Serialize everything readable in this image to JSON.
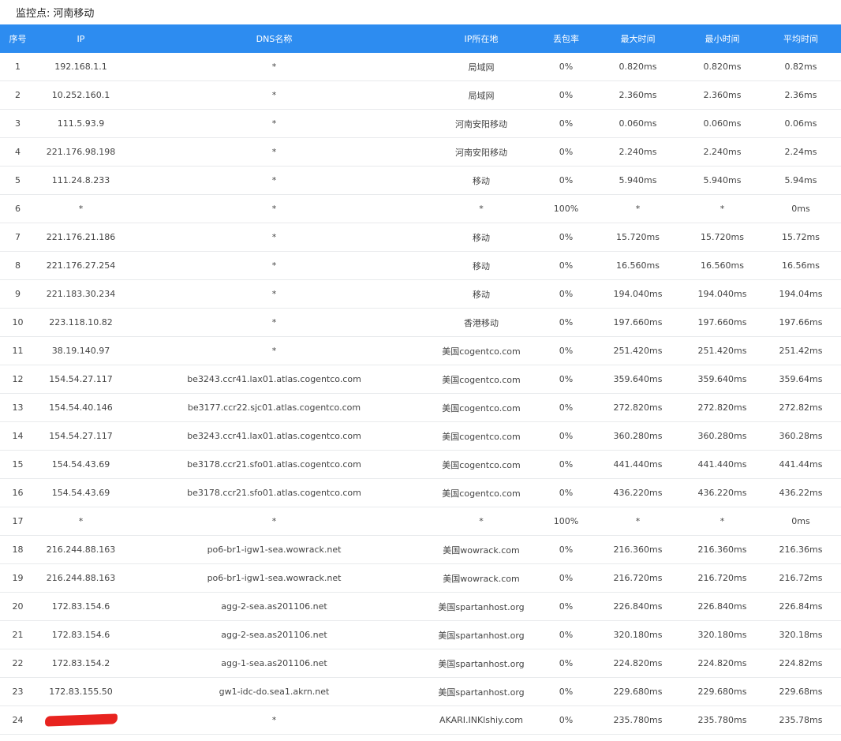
{
  "header": {
    "label": "监控点:",
    "value": "河南移动"
  },
  "table": {
    "columns": [
      "序号",
      "IP",
      "DNS名称",
      "IP所在地",
      "丢包率",
      "最大时间",
      "最小时间",
      "平均时间"
    ],
    "rows": [
      {
        "no": "1",
        "ip": "192.168.1.1",
        "dns": "*",
        "loc": "局域网",
        "loss": "0%",
        "max": "0.820ms",
        "min": "0.820ms",
        "avg": "0.82ms"
      },
      {
        "no": "2",
        "ip": "10.252.160.1",
        "dns": "*",
        "loc": "局域网",
        "loss": "0%",
        "max": "2.360ms",
        "min": "2.360ms",
        "avg": "2.36ms"
      },
      {
        "no": "3",
        "ip": "111.5.93.9",
        "dns": "*",
        "loc": "河南安阳移动",
        "loss": "0%",
        "max": "0.060ms",
        "min": "0.060ms",
        "avg": "0.06ms"
      },
      {
        "no": "4",
        "ip": "221.176.98.198",
        "dns": "*",
        "loc": "河南安阳移动",
        "loss": "0%",
        "max": "2.240ms",
        "min": "2.240ms",
        "avg": "2.24ms"
      },
      {
        "no": "5",
        "ip": "111.24.8.233",
        "dns": "*",
        "loc": "移动",
        "loss": "0%",
        "max": "5.940ms",
        "min": "5.940ms",
        "avg": "5.94ms"
      },
      {
        "no": "6",
        "ip": "*",
        "dns": "*",
        "loc": "*",
        "loss": "100%",
        "max": "*",
        "min": "*",
        "avg": "0ms"
      },
      {
        "no": "7",
        "ip": "221.176.21.186",
        "dns": "*",
        "loc": "移动",
        "loss": "0%",
        "max": "15.720ms",
        "min": "15.720ms",
        "avg": "15.72ms"
      },
      {
        "no": "8",
        "ip": "221.176.27.254",
        "dns": "*",
        "loc": "移动",
        "loss": "0%",
        "max": "16.560ms",
        "min": "16.560ms",
        "avg": "16.56ms"
      },
      {
        "no": "9",
        "ip": "221.183.30.234",
        "dns": "*",
        "loc": "移动",
        "loss": "0%",
        "max": "194.040ms",
        "min": "194.040ms",
        "avg": "194.04ms"
      },
      {
        "no": "10",
        "ip": "223.118.10.82",
        "dns": "*",
        "loc": "香港移动",
        "loss": "0%",
        "max": "197.660ms",
        "min": "197.660ms",
        "avg": "197.66ms"
      },
      {
        "no": "11",
        "ip": "38.19.140.97",
        "dns": "*",
        "loc": "美国cogentco.com",
        "loss": "0%",
        "max": "251.420ms",
        "min": "251.420ms",
        "avg": "251.42ms"
      },
      {
        "no": "12",
        "ip": "154.54.27.117",
        "dns": "be3243.ccr41.lax01.atlas.cogentco.com",
        "loc": "美国cogentco.com",
        "loss": "0%",
        "max": "359.640ms",
        "min": "359.640ms",
        "avg": "359.64ms"
      },
      {
        "no": "13",
        "ip": "154.54.40.146",
        "dns": "be3177.ccr22.sjc01.atlas.cogentco.com",
        "loc": "美国cogentco.com",
        "loss": "0%",
        "max": "272.820ms",
        "min": "272.820ms",
        "avg": "272.82ms"
      },
      {
        "no": "14",
        "ip": "154.54.27.117",
        "dns": "be3243.ccr41.lax01.atlas.cogentco.com",
        "loc": "美国cogentco.com",
        "loss": "0%",
        "max": "360.280ms",
        "min": "360.280ms",
        "avg": "360.28ms"
      },
      {
        "no": "15",
        "ip": "154.54.43.69",
        "dns": "be3178.ccr21.sfo01.atlas.cogentco.com",
        "loc": "美国cogentco.com",
        "loss": "0%",
        "max": "441.440ms",
        "min": "441.440ms",
        "avg": "441.44ms"
      },
      {
        "no": "16",
        "ip": "154.54.43.69",
        "dns": "be3178.ccr21.sfo01.atlas.cogentco.com",
        "loc": "美国cogentco.com",
        "loss": "0%",
        "max": "436.220ms",
        "min": "436.220ms",
        "avg": "436.22ms"
      },
      {
        "no": "17",
        "ip": "*",
        "dns": "*",
        "loc": "*",
        "loss": "100%",
        "max": "*",
        "min": "*",
        "avg": "0ms"
      },
      {
        "no": "18",
        "ip": "216.244.88.163",
        "dns": "po6-br1-igw1-sea.wowrack.net",
        "loc": "美国wowrack.com",
        "loss": "0%",
        "max": "216.360ms",
        "min": "216.360ms",
        "avg": "216.36ms"
      },
      {
        "no": "19",
        "ip": "216.244.88.163",
        "dns": "po6-br1-igw1-sea.wowrack.net",
        "loc": "美国wowrack.com",
        "loss": "0%",
        "max": "216.720ms",
        "min": "216.720ms",
        "avg": "216.72ms"
      },
      {
        "no": "20",
        "ip": "172.83.154.6",
        "dns": "agg-2-sea.as201106.net",
        "loc": "美国spartanhost.org",
        "loss": "0%",
        "max": "226.840ms",
        "min": "226.840ms",
        "avg": "226.84ms"
      },
      {
        "no": "21",
        "ip": "172.83.154.6",
        "dns": "agg-2-sea.as201106.net",
        "loc": "美国spartanhost.org",
        "loss": "0%",
        "max": "320.180ms",
        "min": "320.180ms",
        "avg": "320.18ms"
      },
      {
        "no": "22",
        "ip": "172.83.154.2",
        "dns": "agg-1-sea.as201106.net",
        "loc": "美国spartanhost.org",
        "loss": "0%",
        "max": "224.820ms",
        "min": "224.820ms",
        "avg": "224.82ms"
      },
      {
        "no": "23",
        "ip": "172.83.155.50",
        "dns": "gw1-idc-do.sea1.akrn.net",
        "loc": "美国spartanhost.org",
        "loss": "0%",
        "max": "229.680ms",
        "min": "229.680ms",
        "avg": "229.68ms"
      },
      {
        "no": "24",
        "ip": "",
        "redacted": true,
        "dns": "*",
        "loc": "AKARI.INKlshiy.com",
        "loss": "0%",
        "max": "235.780ms",
        "min": "235.780ms",
        "avg": "235.78ms"
      }
    ]
  },
  "colors": {
    "header_bg": "#2d8cf0",
    "header_text": "#ffffff",
    "row_border": "#e8eaec",
    "redaction": "#e8231f"
  }
}
